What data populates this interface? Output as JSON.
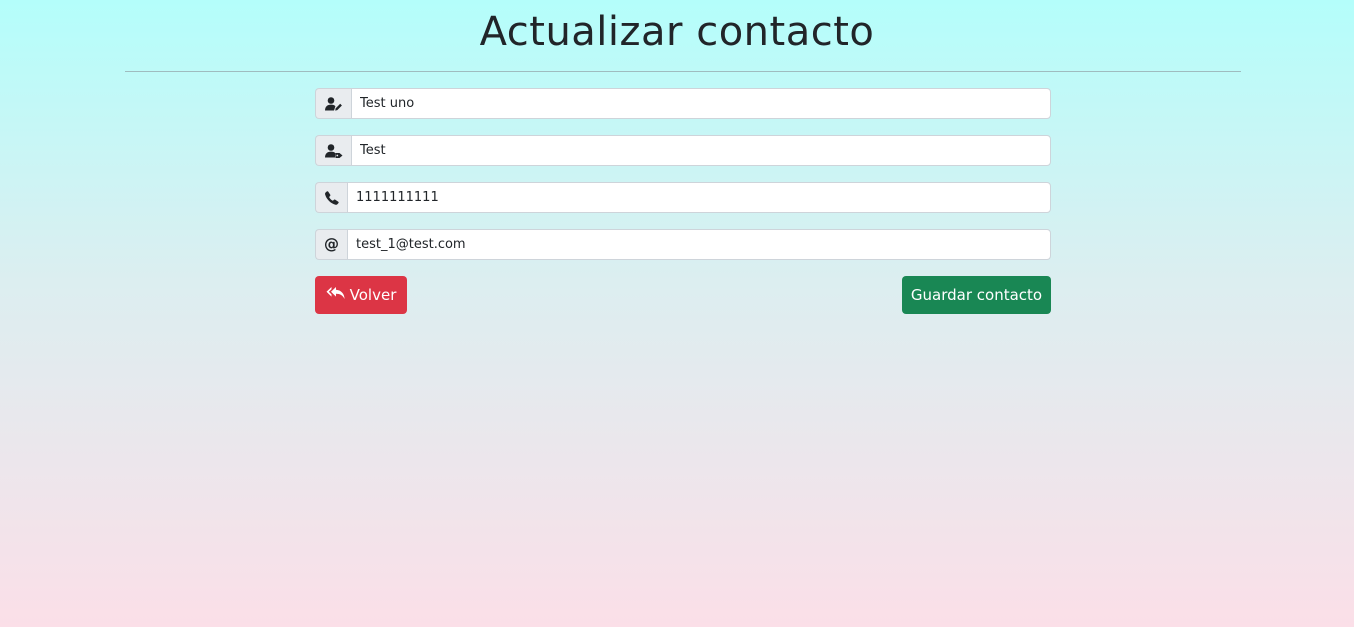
{
  "header": {
    "title": "Actualizar contacto"
  },
  "form": {
    "fields": [
      {
        "icon": "user-pen-icon",
        "value": "Test uno"
      },
      {
        "icon": "user-tag-icon",
        "value": "Test"
      },
      {
        "icon": "phone-icon",
        "value": "1111111111"
      },
      {
        "icon": "at-sign-icon",
        "symbol": "@",
        "value": "test_1@test.com"
      }
    ]
  },
  "actions": {
    "back_label": "Volver",
    "save_label": "Guardar contacto"
  },
  "colors": {
    "danger": "#dc3545",
    "success": "#198754",
    "gradient_top": "#b4fefb",
    "gradient_bottom": "#fbdfe8"
  }
}
